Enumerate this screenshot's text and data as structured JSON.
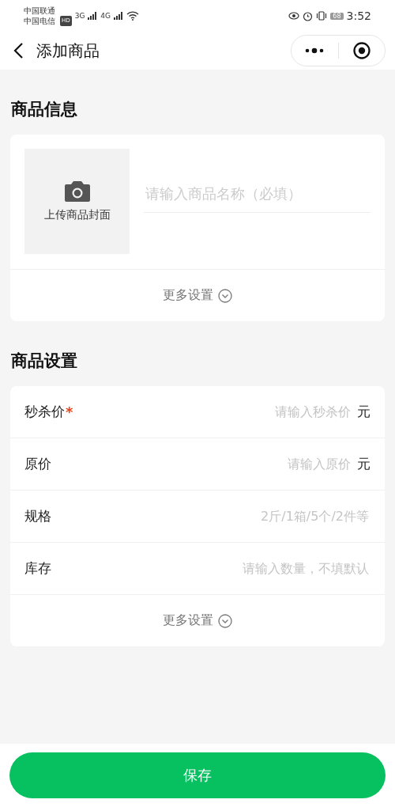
{
  "status_bar": {
    "carrier_1": "中国联通",
    "carrier_2": "中国电信",
    "hd_badge": "HD",
    "network_1": "3G",
    "network_2": "4G",
    "battery": "68",
    "time": "3:52"
  },
  "nav": {
    "title": "添加商品"
  },
  "product_info": {
    "title": "商品信息",
    "cover_label": "上传商品封面",
    "name_field": {
      "placeholder": "请输入商品名称（必填）"
    },
    "more": "更多设置"
  },
  "product_settings": {
    "title": "商品设置",
    "fields": [
      {
        "kind": "price",
        "label": "秒杀价",
        "required_mark": "*",
        "placeholder": "请输入秒杀价",
        "unit": "元"
      },
      {
        "kind": "price",
        "label": "原价",
        "placeholder": "请输入原价",
        "unit": "元"
      },
      {
        "kind": "text",
        "label": "规格",
        "placeholder": "2斤/1箱/5个/2件等"
      },
      {
        "kind": "text",
        "label": "库存",
        "placeholder": "请输入数量，不填默认"
      }
    ],
    "more": "更多设置"
  },
  "save_button": "保存"
}
